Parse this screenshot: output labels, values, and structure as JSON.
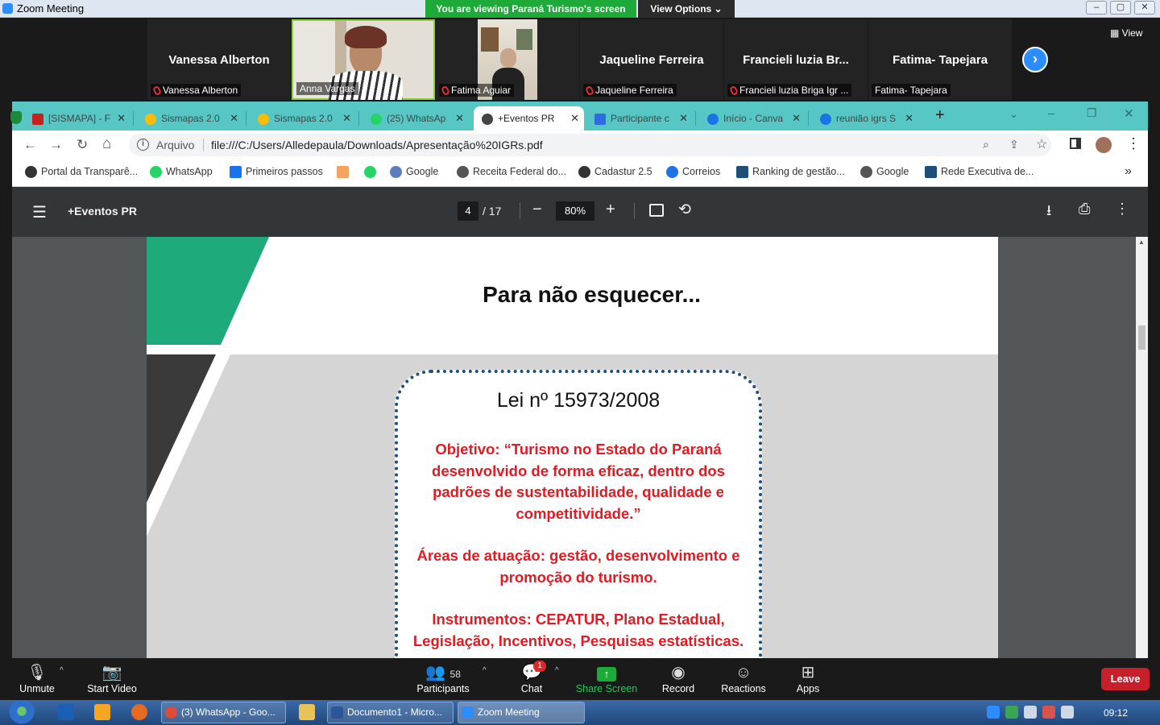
{
  "zoom": {
    "window_title": "Zoom Meeting",
    "banner": "You are viewing Paraná Turismo's screen",
    "view_options": "View Options ⌄",
    "view_button": "View",
    "participants": [
      {
        "big_name": "Vanessa Alberton",
        "label": "Vanessa Alberton",
        "muted": true
      },
      {
        "big_name": "",
        "label": "Anna Vargas",
        "muted": false
      },
      {
        "big_name": "",
        "label": "Fatima Aguiar",
        "muted": true
      },
      {
        "big_name": "Jaqueline Ferreira",
        "label": "Jaqueline Ferreira",
        "muted": true
      },
      {
        "big_name": "Francieli luzia Br...",
        "label": "Francieli luzia Briga Igr ...",
        "muted": true
      },
      {
        "big_name": "Fatima- Tapejara",
        "label": "Fatima- Tapejara",
        "muted": false
      }
    ],
    "toolbar": {
      "unmute": "Unmute",
      "start_video": "Start Video",
      "participants": "Participants",
      "participants_count": "58",
      "chat": "Chat",
      "chat_badge": "1",
      "share_screen": "Share Screen",
      "record": "Record",
      "reactions": "Reactions",
      "apps": "Apps",
      "leave": "Leave"
    }
  },
  "browser": {
    "tabs": [
      {
        "title": "[SISMAPA] - F",
        "color": "#c5221f"
      },
      {
        "title": "Sismapas 2.0",
        "color": "#fbbc04"
      },
      {
        "title": "Sismapas 2.0",
        "color": "#fbbc04"
      },
      {
        "title": "(25) WhatsAp",
        "color": "#25d366"
      },
      {
        "title": "+Eventos PR",
        "color": "#444444"
      },
      {
        "title": "Participante c",
        "color": "#2d6cdf"
      },
      {
        "title": "Início - Canva",
        "color": "#1a73e8"
      },
      {
        "title": "reunião igrs S",
        "color": "#1a73e8"
      }
    ],
    "address_label": "Arquivo",
    "url": "file:///C:/Users/Alledepaula/Downloads/Apresentação%20IGRs.pdf",
    "bookmarks": [
      {
        "title": "Portal da Transparê...",
        "color": "#333333"
      },
      {
        "title": "WhatsApp",
        "color": "#25d366"
      },
      {
        "title": "Primeiros passos",
        "color": "#1a73e8"
      },
      {
        "title": "",
        "color": "#f4a261"
      },
      {
        "title": "",
        "color": "#25d366"
      },
      {
        "title": "Google",
        "color": "#5b7dbd"
      },
      {
        "title": "Receita Federal do...",
        "color": "#555555"
      },
      {
        "title": "Cadastur 2.5",
        "color": "#333333"
      },
      {
        "title": "Correios",
        "color": "#1a73e8"
      },
      {
        "title": "Ranking de gestão...",
        "color": "#1f4e79"
      },
      {
        "title": "Google",
        "color": "#555555"
      },
      {
        "title": "Rede Executiva de...",
        "color": "#1f4e79"
      }
    ],
    "more_bookmarks": "»"
  },
  "pdf": {
    "doc_title": "+Eventos PR",
    "page_current": "4",
    "page_total": "/ 17",
    "zoom": "80%",
    "slide_title": "Para não esquecer...",
    "law": "Lei nº 15973/2008",
    "objective": "Objetivo: “Turismo no Estado do Paraná desenvolvido de forma eficaz, dentro dos padrões de sustentabilidade, qualidade e competitividade.”",
    "areas": "Áreas de atuação: gestão, desenvolvimento e promoção do turismo.",
    "instruments": "Instrumentos: CEPATUR, Plano Estadual, Legislação, Incentivos, Pesquisas estatísticas."
  },
  "taskbar": {
    "whatsapp": "(3) WhatsApp - Goo...",
    "word": "Documento1 - Micro...",
    "zoom": "Zoom Meeting",
    "clock": "09:12"
  }
}
